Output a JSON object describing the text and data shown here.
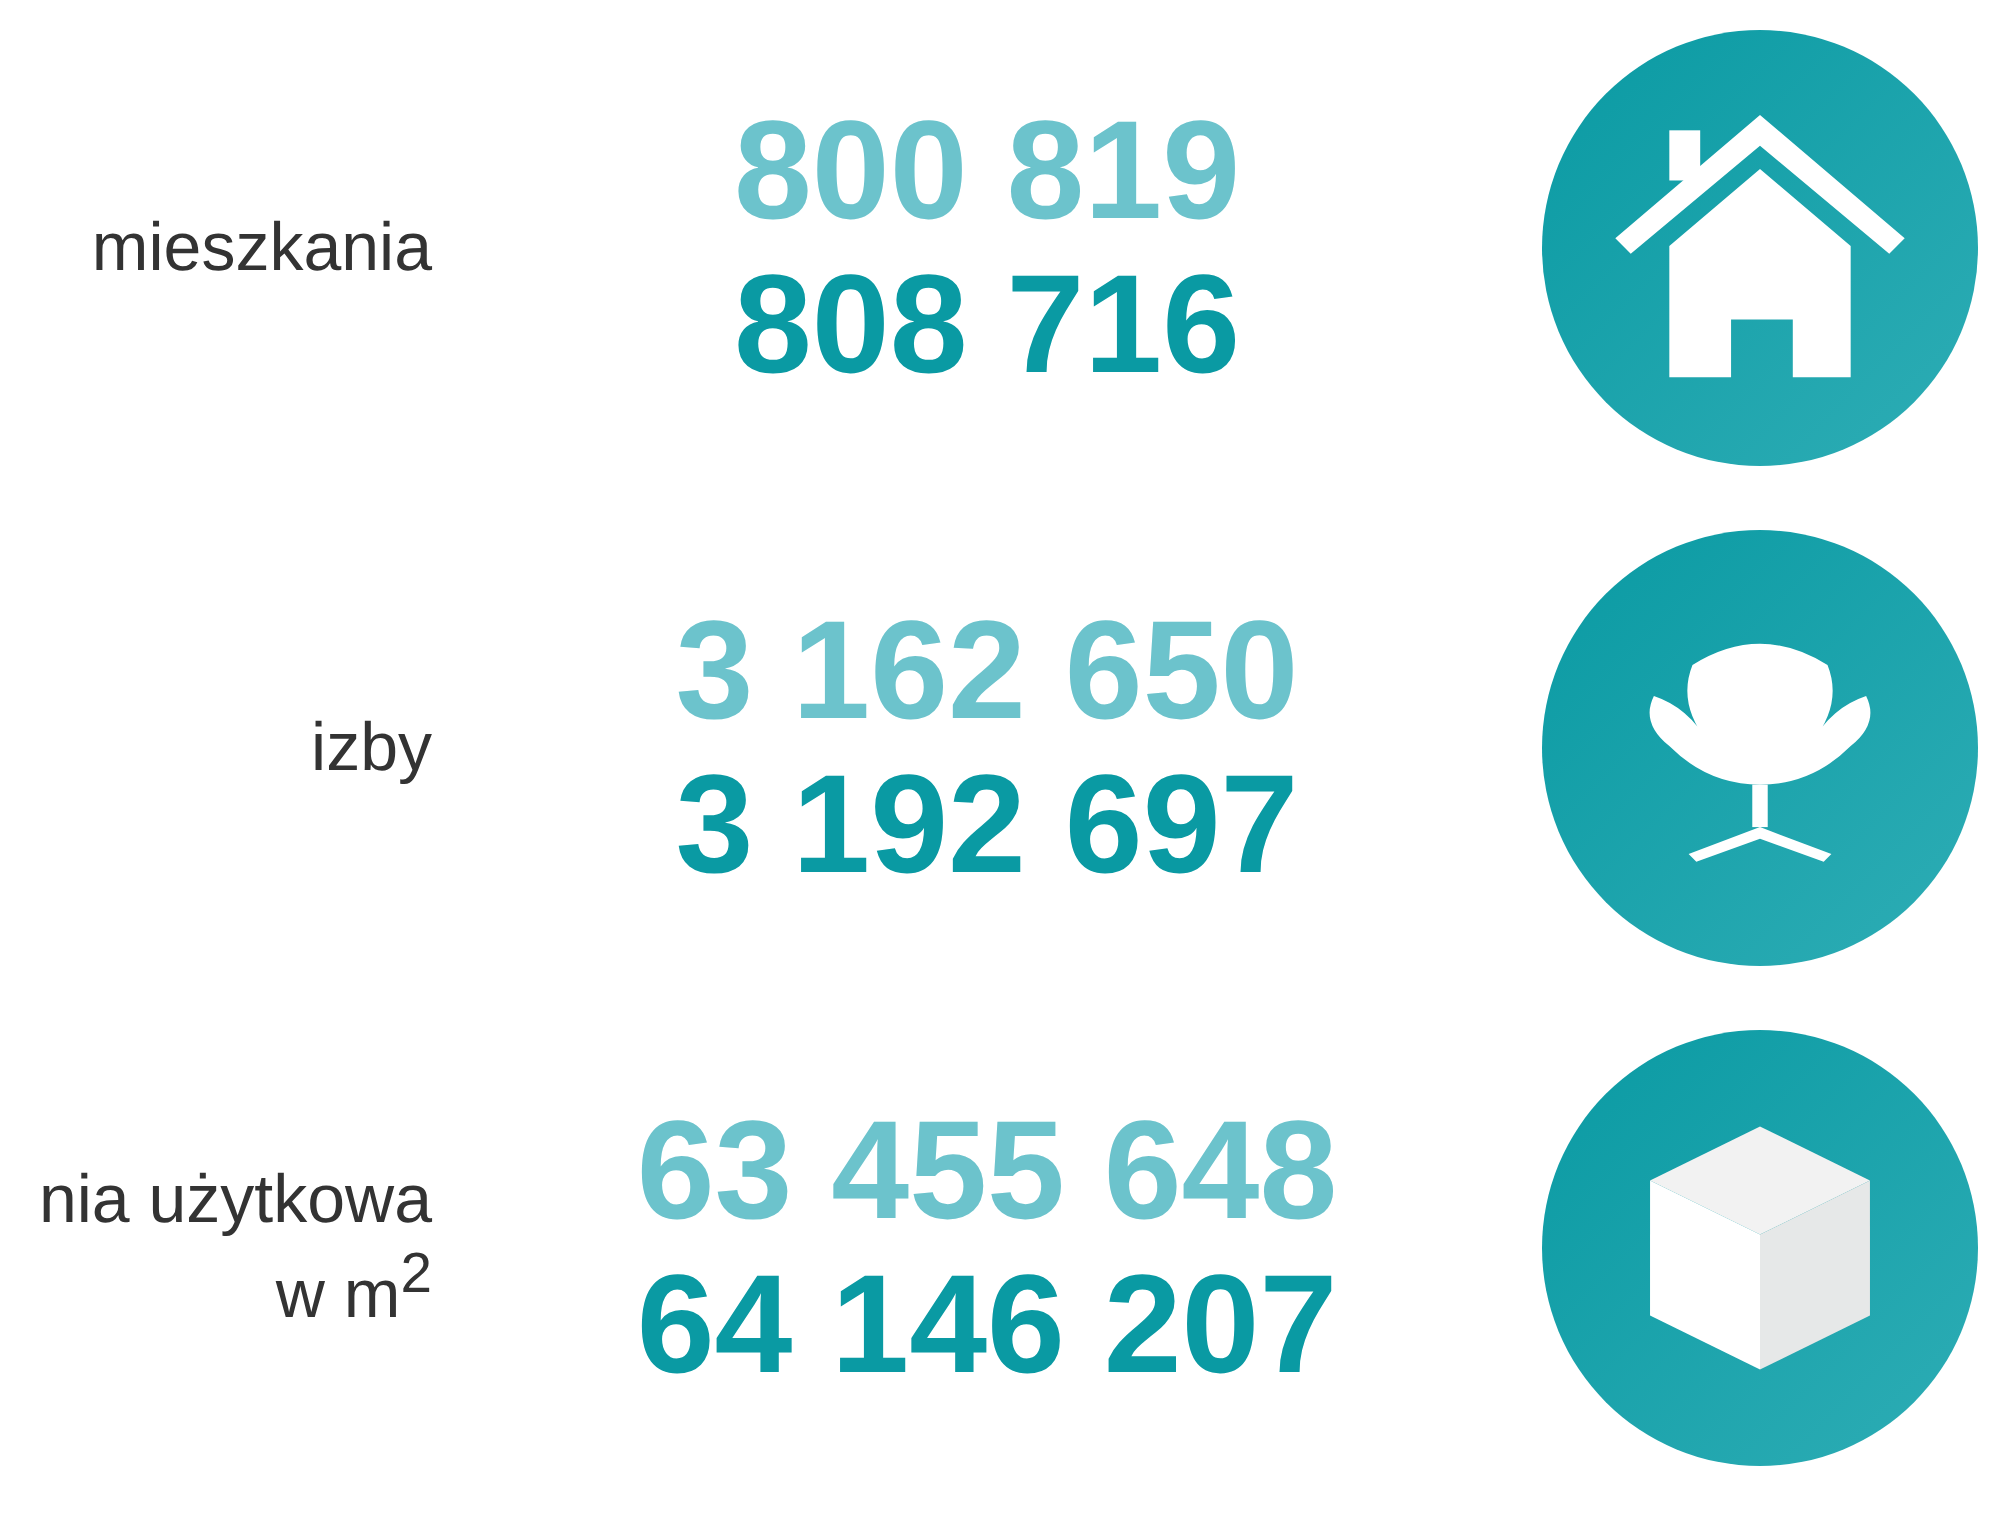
{
  "rows": [
    {
      "label": [
        "mieszkania"
      ],
      "values": [
        "800 819",
        "808 716"
      ],
      "kind": "house"
    },
    {
      "label": [
        "izby"
      ],
      "values": [
        "3 162 650",
        "3 192 697"
      ],
      "kind": "chair"
    },
    {
      "label": [
        "nia użytkowa",
        "w m$^{2}$"
      ],
      "values": [
        "63 455 648",
        "64 146 207"
      ],
      "kind": "cube"
    }
  ]
}
